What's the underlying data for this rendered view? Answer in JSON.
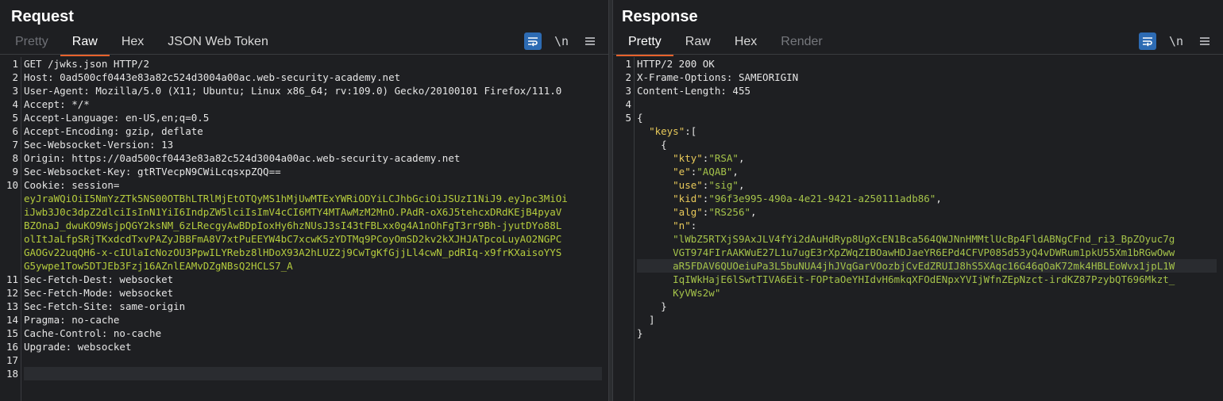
{
  "request": {
    "title": "Request",
    "tabs": [
      {
        "label": "Pretty",
        "state": "disabled"
      },
      {
        "label": "Raw",
        "state": "active"
      },
      {
        "label": "Hex",
        "state": "normal"
      },
      {
        "label": "JSON Web Token",
        "state": "normal"
      }
    ],
    "lines": [
      {
        "n": "1",
        "key": "GET /jwks.json HTTP/2",
        "val": ""
      },
      {
        "n": "2",
        "key": "Host: ",
        "val": "0ad500cf0443e83a82c524d3004a00ac.web-security-academy.net"
      },
      {
        "n": "3",
        "key": "User-Agent: ",
        "val": "Mozilla/5.0 (X11; Ubuntu; Linux x86_64; rv:109.0) Gecko/20100101 Firefox/111.0"
      },
      {
        "n": "4",
        "key": "Accept: ",
        "val": "*/*"
      },
      {
        "n": "5",
        "key": "Accept-Language: ",
        "val": "en-US,en;q=0.5"
      },
      {
        "n": "6",
        "key": "Accept-Encoding: ",
        "val": "gzip, deflate"
      },
      {
        "n": "7",
        "key": "Sec-Websocket-Version: ",
        "val": "13"
      },
      {
        "n": "8",
        "key": "Origin: ",
        "val": "https://0ad500cf0443e83a82c524d3004a00ac.web-security-academy.net"
      },
      {
        "n": "9",
        "key": "Sec-Websocket-Key: ",
        "val": "gtRTVecpN9CWiLcqsxpZQQ=="
      },
      {
        "n": "10",
        "key": "Cookie: ",
        "val": "session="
      }
    ],
    "cookie_wrapped": [
      "eyJraWQiOiI5NmYzZTk5NS00OTBhLTRlMjEtOTQyMS1hMjUwMTExYWRiODYiLCJhbGciOiJSUzI1NiJ9.eyJpc3MiOi",
      "iJwb3J0c3dpZ2dlciIsInN1YiI6IndpZW5lciIsImV4cCI6MTY4MTAwMzM2MnO.PAdR-oX6J5tehcxDRdKEjB4pyaV",
      "BZOnaJ_dwuKO9WsjpQGY2ksNM_6zLRecgyAwBDpIoxHy6hzNUsJ3sI43tFBLxx0g4A1nOhFgT3rr9Bh-jyutDYo88L",
      "olItJaLfpSRjTKxdcdTxvPAZyJBBFmA8V7xtPuEEYW4bC7xcwK5zYDTMq9PCoyOmSD2kv2kXJHJATpcoLuyAO2NGPC",
      "GAOGv22uqQH6-x-cIUlaIcNozOU3PpwILYRebz8lHDoX93A2hLUZ2j9CwTgKfGjjLl4cwN_pdRIq-x9frKXaisoYYS",
      "G5ywpe1Tow5DTJEb3Fzj16AZnlEAMvDZgNBsQ2HCLS7_A"
    ],
    "lines_after": [
      {
        "n": "11",
        "key": "Sec-Fetch-Dest: ",
        "val": "websocket"
      },
      {
        "n": "12",
        "key": "Sec-Fetch-Mode: ",
        "val": "websocket"
      },
      {
        "n": "13",
        "key": "Sec-Fetch-Site: ",
        "val": "same-origin"
      },
      {
        "n": "14",
        "key": "Pragma: ",
        "val": "no-cache"
      },
      {
        "n": "15",
        "key": "Cache-Control: ",
        "val": "no-cache"
      },
      {
        "n": "16",
        "key": "Upgrade: ",
        "val": "websocket"
      },
      {
        "n": "17",
        "key": "",
        "val": ""
      },
      {
        "n": "18",
        "key": "",
        "val": ""
      }
    ]
  },
  "response": {
    "title": "Response",
    "tabs": [
      {
        "label": "Pretty",
        "state": "active"
      },
      {
        "label": "Raw",
        "state": "normal"
      },
      {
        "label": "Hex",
        "state": "normal"
      },
      {
        "label": "Render",
        "state": "dimmed"
      }
    ],
    "header_lines": [
      {
        "n": "1",
        "key": "HTTP/2 200 OK",
        "val": ""
      },
      {
        "n": "2",
        "key": "X-Frame-Options: ",
        "val": "SAMEORIGIN"
      },
      {
        "n": "3",
        "key": "Content-Length: ",
        "val": "455"
      },
      {
        "n": "4",
        "key": "",
        "val": ""
      },
      {
        "n": "5",
        "key": "{",
        "val": ""
      }
    ],
    "json": {
      "keys_key": "\"keys\"",
      "kty_key": "\"kty\"",
      "kty_val": "\"RSA\"",
      "e_key": "\"e\"",
      "e_val": "\"AQAB\"",
      "use_key": "\"use\"",
      "use_val": "\"sig\"",
      "kid_key": "\"kid\"",
      "kid_val": "\"96f3e995-490a-4e21-9421-a250111adb86\"",
      "alg_key": "\"alg\"",
      "alg_val": "\"RS256\"",
      "n_key": "\"n\"",
      "n_wrapped": [
        "\"lWbZ5RTXjS9AxJLV4fYi2dAuHdRyp8UgXcEN1Bca564QWJNnHMMtlUcBp4FldABNgCFnd_ri3_BpZOyuc7g",
        "VGT974FIrAAKWuE27L1u7ugE3rXpZWqZIBOawHDJaeYR6EPd4CFVP085d53yQ4vDWRum1pkU55Xm1bRGwOww",
        "aR5FDAV6QUOeiuPa3L5buNUA4jhJVqGarVOozbjCvEdZRUIJ8hS5XAqc16G46qOaK72mk4HBLEoWvx1jpL1W",
        "IqIWkHajE6lSwtTIVA6Eit-FOPtaOeYHIdvH6mkqXFOdENpxYVIjWfnZEpNzct-irdKZ87PzybQT696Mkzt_",
        "KyVWs2w\""
      ]
    }
  },
  "icons": {
    "wrap": "wrap-icon",
    "newline": "\\n",
    "menu": "menu-icon"
  }
}
